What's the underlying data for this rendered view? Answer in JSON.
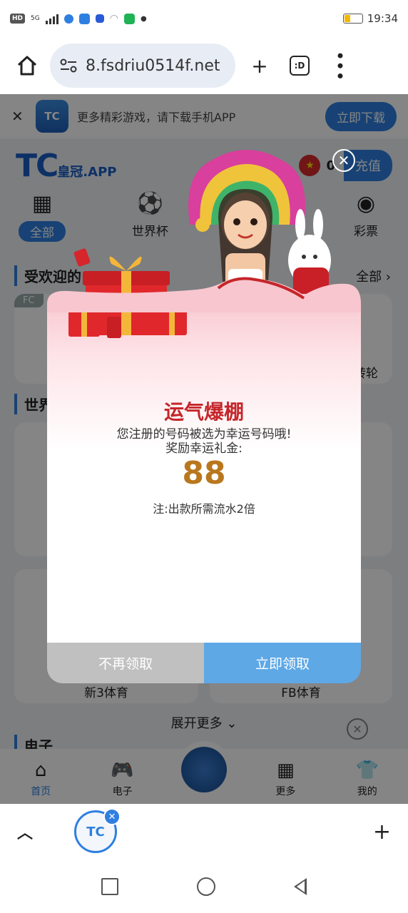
{
  "status_bar": {
    "network": "HD",
    "signal": "5G",
    "time": "19:34"
  },
  "browser": {
    "url": "8.fsdriu0514f.net",
    "tab_icon_text": ":D"
  },
  "page": {
    "download_banner": {
      "logo_text": "TC",
      "text": "更多精彩游戏，请下载手机APP",
      "button": "立即下载"
    },
    "brand": {
      "main": "TC",
      "sub": "皇冠.APP"
    },
    "balance": "0",
    "recharge_button": "充值",
    "categories": [
      {
        "label": "全部",
        "icon": "grid-icon"
      },
      {
        "label": "世界杯",
        "icon": "soccer-ball-icon"
      },
      {
        "label": "",
        "icon": "roulette-icon"
      },
      {
        "label": "彩票",
        "icon": "lottery-icon"
      }
    ],
    "section_popular": "受欢迎的",
    "section_more": "全部",
    "section_world": "世界",
    "card_tags": {
      "fc": "FC",
      "wheel": "转轮"
    },
    "cards": [
      "新3体育",
      "FB体育"
    ],
    "expand_more": "展开更多",
    "section_electronic": "电子",
    "bottom_nav": [
      {
        "label": "首页",
        "icon": "home-icon"
      },
      {
        "label": "电子",
        "icon": "gamepad-icon"
      },
      {
        "label": "",
        "icon": "trophy-icon"
      },
      {
        "label": "更多",
        "icon": "grid-icon"
      },
      {
        "label": "我的",
        "icon": "shirt-icon"
      }
    ]
  },
  "popup": {
    "title": "运气爆棚",
    "message_line1": "您注册的号码被选为幸运号码哦!",
    "message_line2": "奖励幸运礼金:",
    "amount": "88",
    "note": "注:出款所需流水2倍",
    "decline_button": "不再领取",
    "claim_button": "立即领取"
  },
  "browser_bottom": {
    "tab_logo": "TC"
  }
}
